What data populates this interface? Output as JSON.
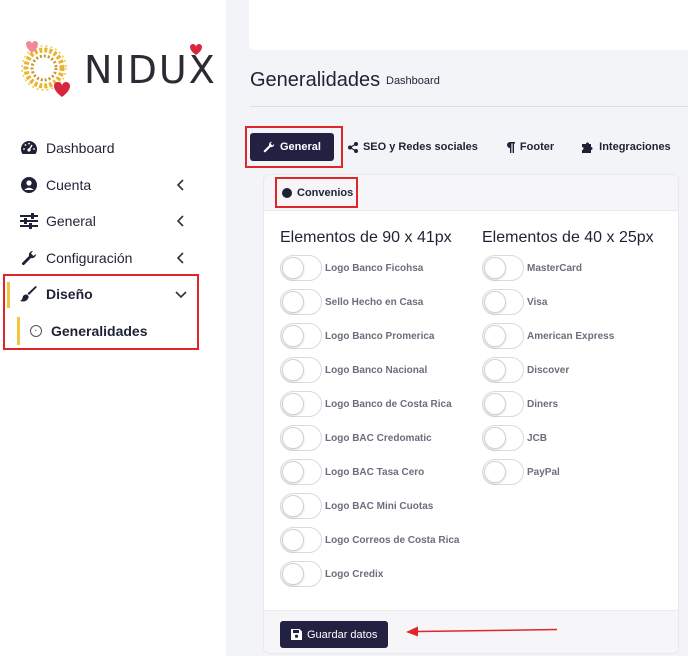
{
  "brand": {
    "name": "NIDUX"
  },
  "sidebar": {
    "items": [
      {
        "label": "Dashboard",
        "icon": "gauge-icon"
      },
      {
        "label": "Cuenta",
        "icon": "user-circle-icon"
      },
      {
        "label": "General",
        "icon": "sliders-icon"
      },
      {
        "label": "Configuración",
        "icon": "wrench-icon"
      },
      {
        "label": "Diseño",
        "icon": "paintbrush-icon"
      }
    ],
    "sub_item": "Generalidades"
  },
  "header": {
    "title": "Generalidades",
    "breadcrumb": "Dashboard"
  },
  "tabs": [
    {
      "label": "General",
      "icon": "wrench-icon",
      "active": true
    },
    {
      "label": "SEO y Redes sociales",
      "icon": "share-icon"
    },
    {
      "label": "Footer",
      "icon": "paragraph-icon"
    },
    {
      "label": "Integraciones",
      "icon": "puzzle-icon"
    }
  ],
  "section": {
    "label": "Convenios"
  },
  "columns": [
    {
      "title": "Elementos de 90 x 41px",
      "items": [
        "Logo Banco Ficohsa",
        "Sello Hecho en Casa",
        "Logo Banco Promerica",
        "Logo Banco Nacional",
        "Logo Banco de Costa Rica",
        "Logo BAC Credomatic",
        "Logo BAC Tasa Cero",
        "Logo BAC Mini Cuotas",
        "Logo Correos de Costa Rica",
        "Logo Credix"
      ]
    },
    {
      "title": "Elementos de 40 x 25px",
      "items": [
        "MasterCard",
        "Visa",
        "American Express",
        "Discover",
        "Diners",
        "JCB",
        "PayPal"
      ]
    }
  ],
  "save_button": {
    "label": "Guardar datos"
  },
  "colors": {
    "primary": "#232142",
    "accent": "#f5c542",
    "highlight": "#e0262b"
  }
}
